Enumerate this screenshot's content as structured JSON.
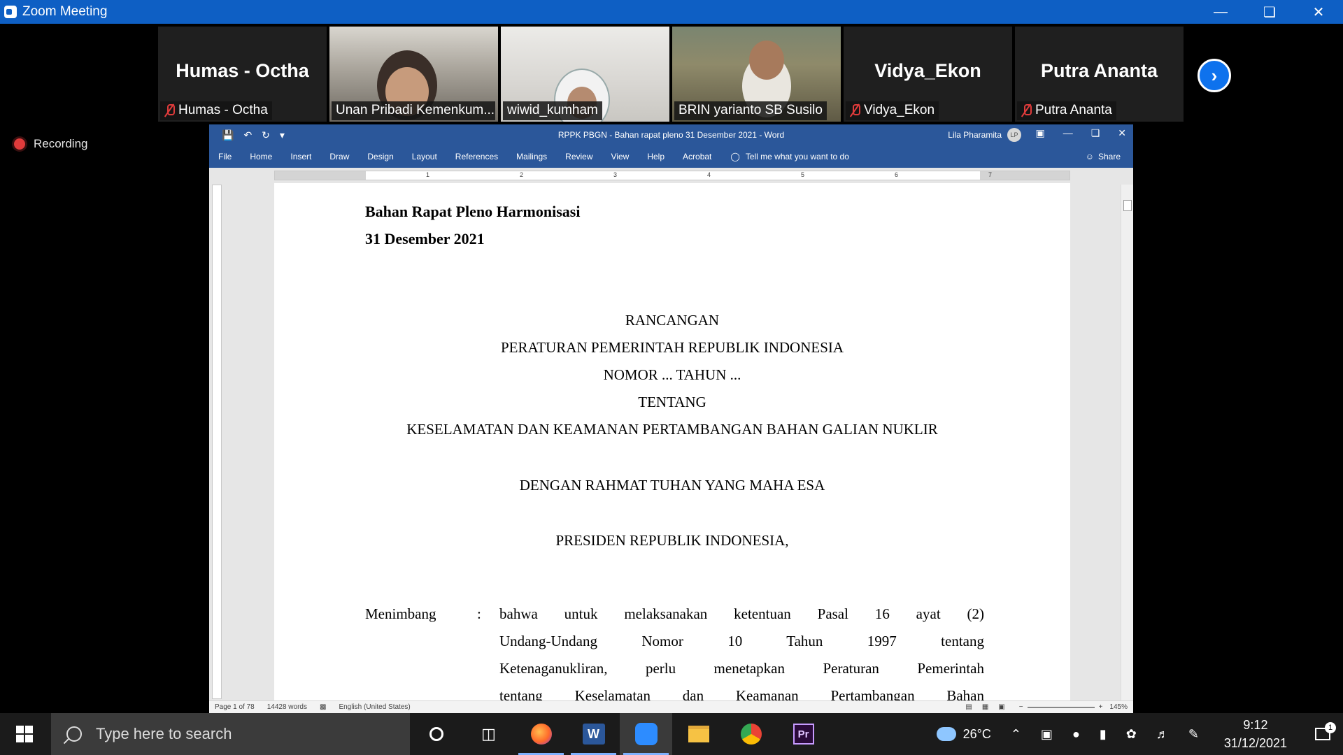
{
  "zoom": {
    "window_title": "Zoom Meeting",
    "recording_label": "Recording",
    "participants": [
      {
        "big_name": "Humas - Octha",
        "label": "Humas - Octha",
        "muted": true,
        "video": false
      },
      {
        "big_name": "",
        "label": "Unan Pribadi Kemenkum...",
        "muted": false,
        "video": true
      },
      {
        "big_name": "",
        "label": "wiwid_kumham",
        "muted": false,
        "video": true
      },
      {
        "big_name": "",
        "label": "BRIN yarianto SB Susilo",
        "muted": false,
        "video": true,
        "active": true
      },
      {
        "big_name": "Vidya_Ekon",
        "label": "Vidya_Ekon",
        "muted": true,
        "video": false
      },
      {
        "big_name": "Putra Ananta",
        "label": "Putra Ananta",
        "muted": true,
        "video": false
      }
    ],
    "next_page_icon": "chevron-right-icon"
  },
  "word": {
    "doc_title": "RPPK PBGN - Bahan rapat pleno 31 Desember 2021  -  Word",
    "user_name": "Lila Pharamita",
    "user_initials": "LP",
    "ribbon_tabs": [
      "File",
      "Home",
      "Insert",
      "Draw",
      "Design",
      "Layout",
      "References",
      "Mailings",
      "Review",
      "View",
      "Help",
      "Acrobat"
    ],
    "tell_me": "Tell me what you want to do",
    "share": "Share",
    "ruler_numbers": [
      "1",
      "2",
      "3",
      "4",
      "5",
      "6",
      "7"
    ],
    "document": {
      "heading1": "Bahan Rapat Pleno Harmonisasi",
      "heading2": "31 Desember 2021",
      "center_lines": [
        "RANCANGAN",
        "PERATURAN PEMERINTAH REPUBLIK INDONESIA",
        "NOMOR ... TAHUN ...",
        "TENTANG",
        "KESELAMATAN DAN KEAMANAN PERTAMBANGAN BAHAN GALIAN NUKLIR"
      ],
      "blessing": "DENGAN RAHMAT TUHAN YANG MAHA ESA",
      "president": "PRESIDEN REPUBLIK INDONESIA,",
      "considering_label": "Menimbang",
      "considering_colon": ":",
      "considering_lines": [
        "bahwa untuk melaksanakan ketentuan Pasal 16 ayat (2)",
        "Undang-Undang Nomor 10 Tahun 1997 tentang",
        "Ketenaganukliran, perlu menetapkan Peraturan Pemerintah",
        "tentang Keselamatan dan Keamanan Pertambangan Bahan"
      ]
    },
    "status": {
      "page": "Page 1 of 78",
      "words": "14428 words",
      "language": "English (United States)",
      "zoom": "145%"
    }
  },
  "taskbar": {
    "search_placeholder": "Type here to search",
    "weather": "26°C",
    "time": "9:12",
    "date": "31/12/2021",
    "notification_count": "1"
  },
  "colors": {
    "zoom_blue": "#0e5fc4",
    "word_blue": "#2b579a",
    "active_speaker": "#9bd13e",
    "muted_red": "#e03b3b"
  }
}
